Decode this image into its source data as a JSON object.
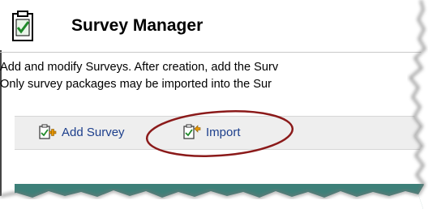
{
  "header": {
    "title": "Survey Manager",
    "icon": "checklist-icon"
  },
  "description": {
    "line1": "Add and modify Surveys. After creation, add the Surv",
    "line2": "Only survey packages may be imported into the Sur"
  },
  "toolbar": {
    "add_label": "Add Survey",
    "add_icon": "add-survey-icon",
    "import_label": "Import",
    "import_icon": "import-icon"
  },
  "colors": {
    "link": "#1d3f8c",
    "teal_band": "#3d8079",
    "highlight_ellipse": "#8b1a1a"
  }
}
